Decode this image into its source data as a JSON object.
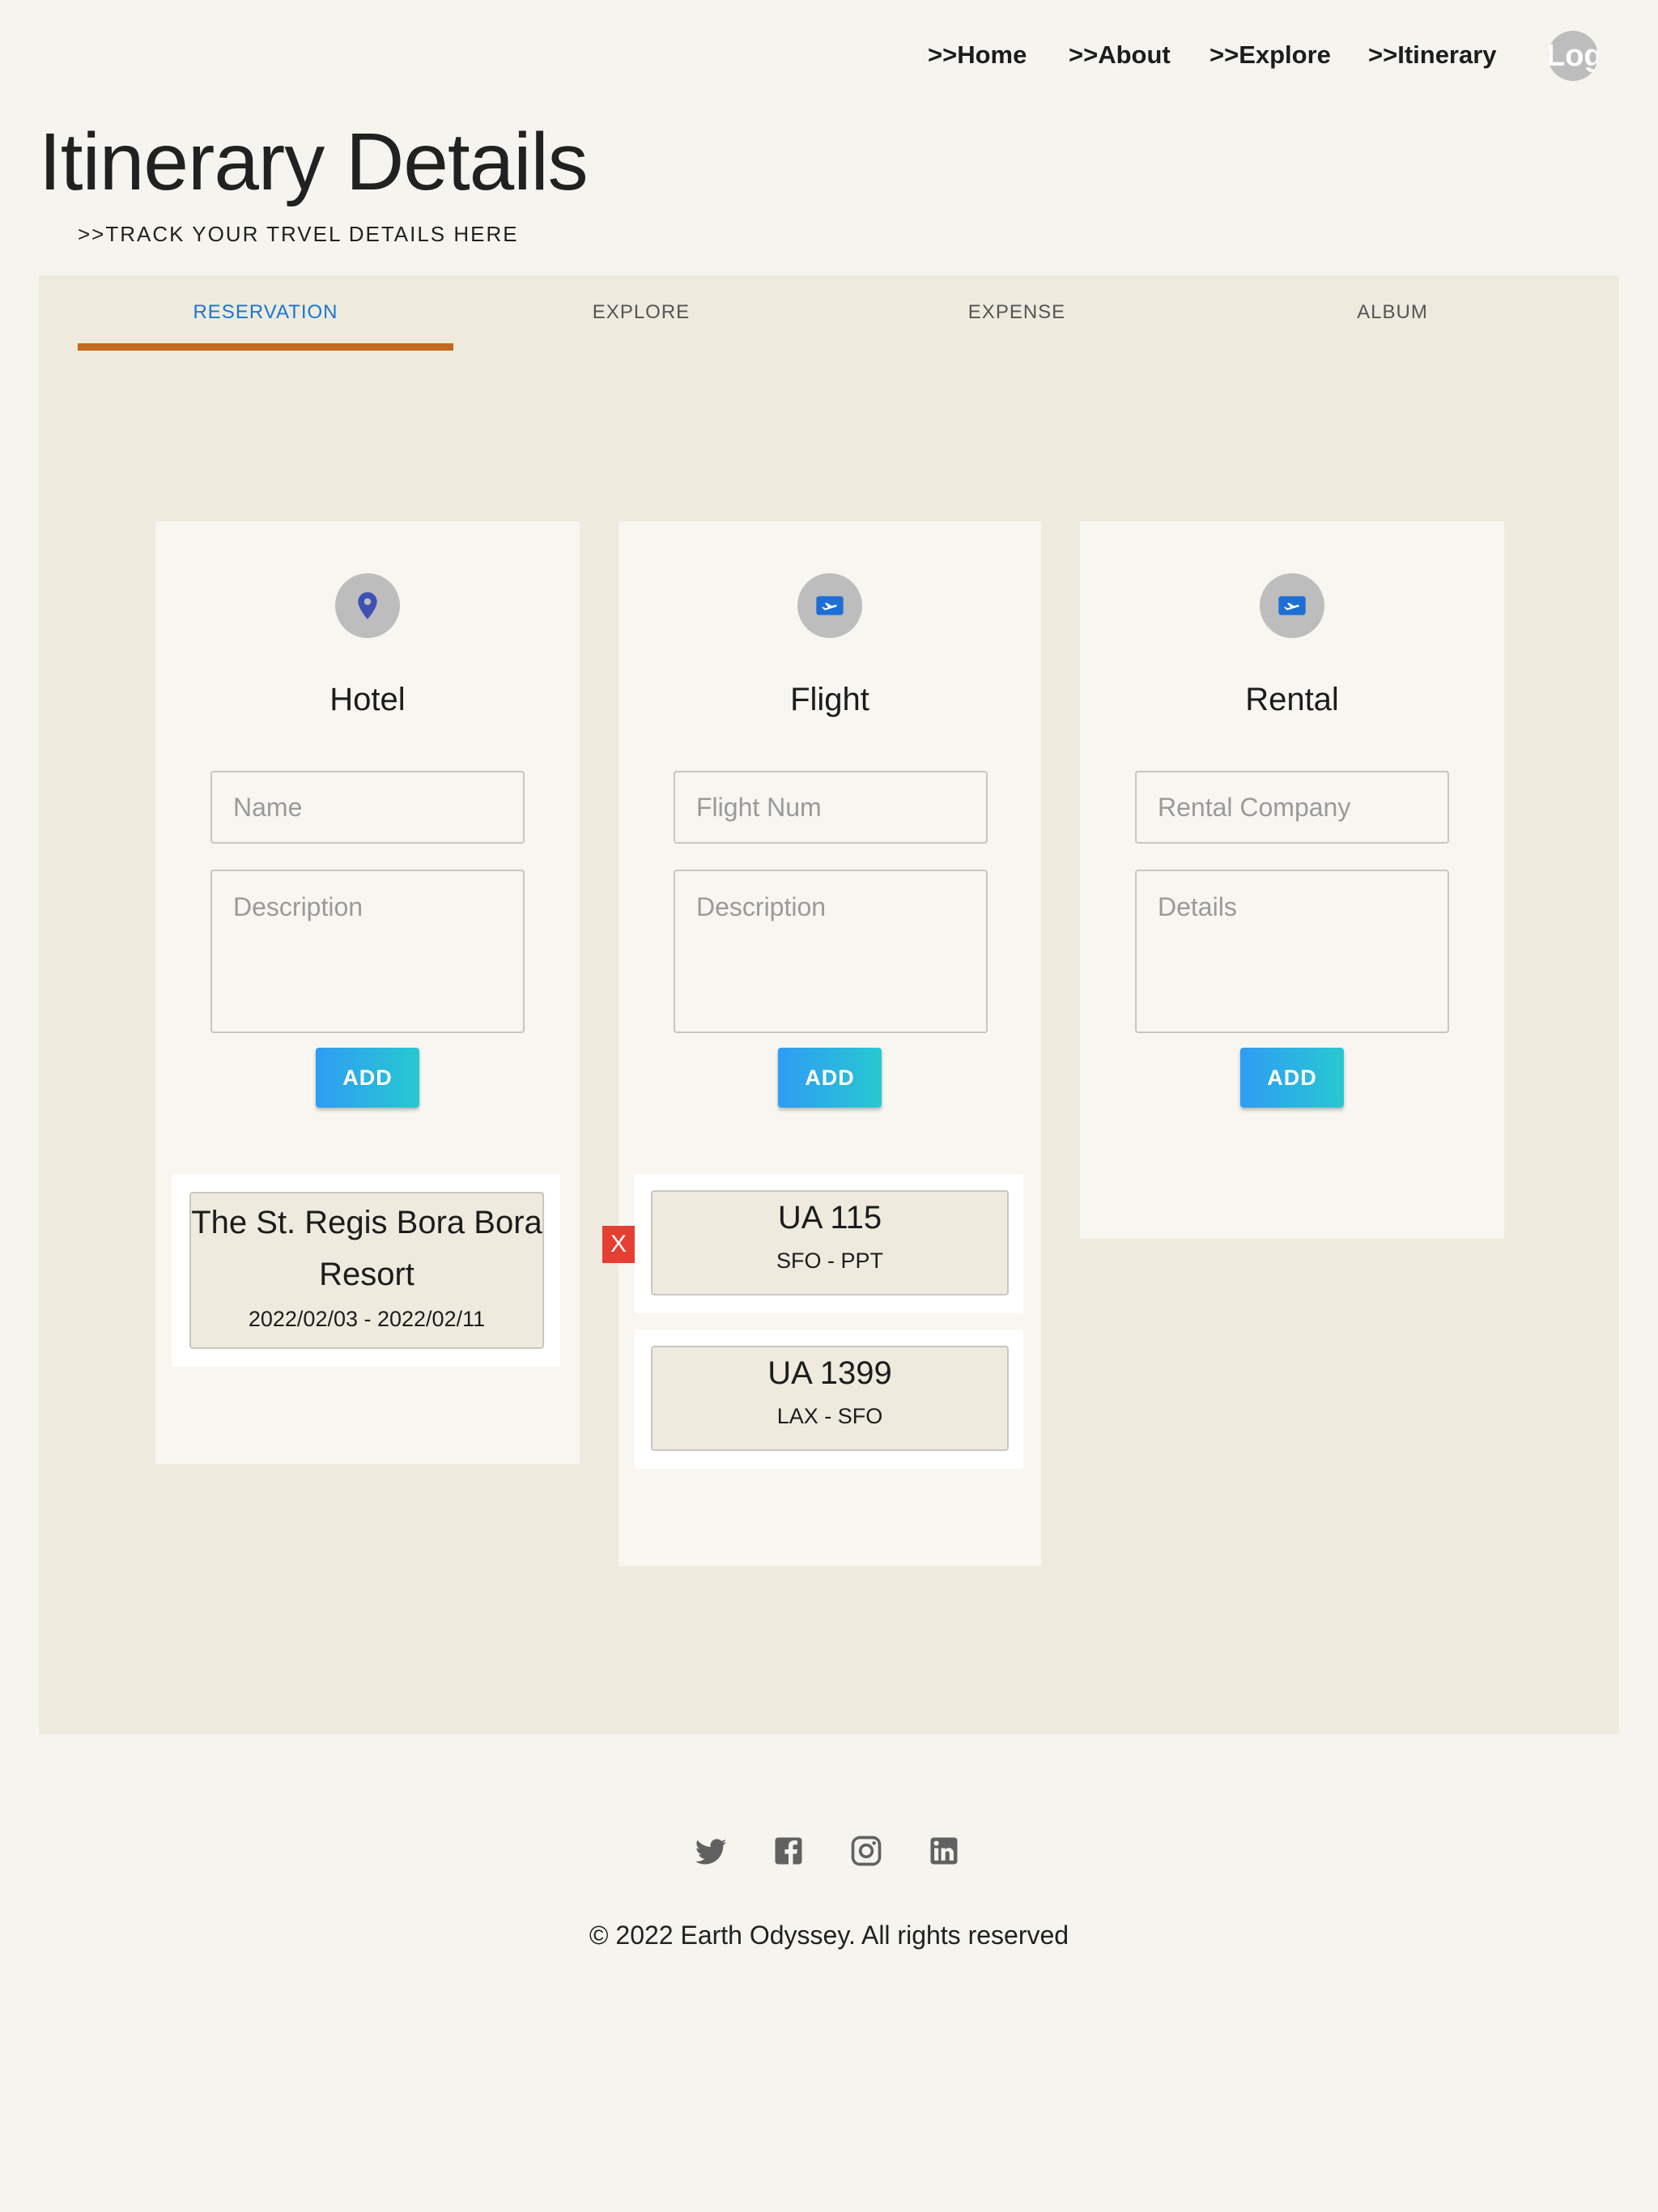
{
  "nav": {
    "links": [
      ">>Home",
      ">>About",
      ">>Explore",
      ">>Itinerary"
    ],
    "login_label": "Log"
  },
  "header": {
    "title": "Itinerary Details",
    "subtitle": ">>TRACK YOUR TRVEL DETAILS HERE"
  },
  "tabs": [
    "RESERVATION",
    "EXPLORE",
    "EXPENSE",
    "ALBUM"
  ],
  "active_tab": "RESERVATION",
  "colors": {
    "active_tab_text": "#1976d2",
    "tab_indicator": "#c26a1d",
    "add_button_gradient": [
      "#2f9cf3",
      "#27c8d1"
    ],
    "delete_button": "#e43f32"
  },
  "hotel": {
    "icon": "location-pin-icon",
    "title": "Hotel",
    "name_placeholder": "Name",
    "description_placeholder": "Description",
    "add_label": "ADD",
    "items": [
      {
        "title": "The St. Regis Bora Bora Resort",
        "dates": "2022/02/03 - 2022/02/11"
      }
    ]
  },
  "flight": {
    "icon": "flight-ticket-icon",
    "title": "Flight",
    "name_placeholder": "Flight Num",
    "description_placeholder": "Description",
    "add_label": "ADD",
    "delete_label": "X",
    "items": [
      {
        "title": "UA 115",
        "route": "SFO - PPT"
      },
      {
        "title": "UA 1399",
        "route": "LAX - SFO"
      }
    ]
  },
  "rental": {
    "icon": "rental-ticket-icon",
    "title": "Rental",
    "name_placeholder": "Rental Company",
    "description_placeholder": "Details",
    "add_label": "ADD"
  },
  "footer": {
    "social_icons": [
      "twitter-icon",
      "facebook-icon",
      "instagram-icon",
      "linkedin-icon"
    ],
    "copyright": "© 2022 Earth Odyssey. All rights reserved"
  }
}
